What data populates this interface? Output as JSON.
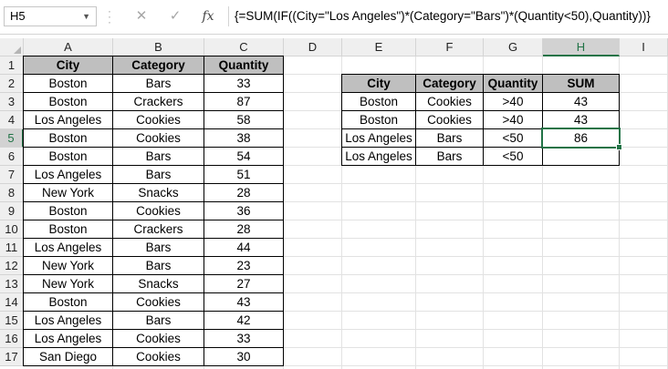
{
  "formula_bar": {
    "name_box": "H5",
    "cancel_icon": "✕",
    "enter_icon": "✓",
    "fx_label": "fx",
    "formula": "{=SUM(IF((City=\"Los Angeles\")*(Category=\"Bars\")*(Quantity<50),Quantity))}"
  },
  "columns": [
    "A",
    "B",
    "C",
    "D",
    "E",
    "F",
    "G",
    "H",
    "I"
  ],
  "rows": [
    "1",
    "2",
    "3",
    "4",
    "5",
    "6",
    "7",
    "8",
    "9",
    "10",
    "11",
    "12",
    "13",
    "14",
    "15",
    "16",
    "17"
  ],
  "selected_cell": {
    "column": "H",
    "row": "5"
  },
  "data_table": {
    "headers": [
      "City",
      "Category",
      "Quantity"
    ],
    "rows": [
      [
        "Boston",
        "Bars",
        "33"
      ],
      [
        "Boston",
        "Crackers",
        "87"
      ],
      [
        "Los Angeles",
        "Cookies",
        "58"
      ],
      [
        "Boston",
        "Cookies",
        "38"
      ],
      [
        "Boston",
        "Bars",
        "54"
      ],
      [
        "Los Angeles",
        "Bars",
        "51"
      ],
      [
        "New York",
        "Snacks",
        "28"
      ],
      [
        "Boston",
        "Cookies",
        "36"
      ],
      [
        "Boston",
        "Crackers",
        "28"
      ],
      [
        "Los Angeles",
        "Bars",
        "44"
      ],
      [
        "New York",
        "Bars",
        "23"
      ],
      [
        "New York",
        "Snacks",
        "27"
      ],
      [
        "Boston",
        "Cookies",
        "43"
      ],
      [
        "Los Angeles",
        "Bars",
        "42"
      ],
      [
        "Los Angeles",
        "Cookies",
        "33"
      ],
      [
        "San Diego",
        "Cookies",
        "30"
      ]
    ]
  },
  "criteria_table": {
    "headers": [
      "City",
      "Category",
      "Quantity",
      "SUM"
    ],
    "rows": [
      [
        "Boston",
        "Cookies",
        ">40",
        "43"
      ],
      [
        "Boston",
        "Cookies",
        ">40",
        "43"
      ],
      [
        "Los Angeles",
        "Bars",
        "<50",
        "86"
      ],
      [
        "Los Angeles",
        "Bars",
        "<50",
        ""
      ]
    ]
  },
  "colors": {
    "header_fill": "#bfbfbf",
    "selection": "#217346"
  }
}
